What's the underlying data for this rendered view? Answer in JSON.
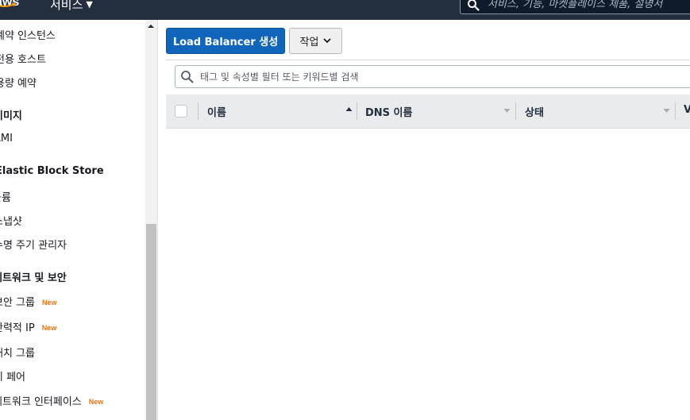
{
  "topbar": {
    "logo_text": "aws",
    "services_label": "서비스",
    "search_placeholder": "서비스, 기능, 마켓플레이스 제품, 설명서"
  },
  "sidebar": {
    "items": [
      {
        "label": "예약 인스턴스",
        "kind": "item"
      },
      {
        "label": "전용 호스트",
        "kind": "item"
      },
      {
        "label": "용량 예약",
        "kind": "item"
      },
      {
        "label": "이미지",
        "kind": "heading"
      },
      {
        "label": "AMI",
        "kind": "item"
      },
      {
        "label": "Elastic Block Store",
        "kind": "heading"
      },
      {
        "label": "볼륨",
        "kind": "item"
      },
      {
        "label": "스냅샷",
        "kind": "item"
      },
      {
        "label": "수명 주기 관리자",
        "kind": "item"
      },
      {
        "label": "네트워크 및 보안",
        "kind": "heading"
      },
      {
        "label": "보안 그룹",
        "kind": "item",
        "badge": "New"
      },
      {
        "label": "탄력적 IP",
        "kind": "item",
        "badge": "New"
      },
      {
        "label": "배치 그룹",
        "kind": "item"
      },
      {
        "label": "키 페어",
        "kind": "item"
      },
      {
        "label": "네트워크 인터페이스",
        "kind": "item",
        "badge": "New"
      }
    ]
  },
  "toolbar": {
    "create_lb_label": "Load Balancer 생성",
    "actions_label": "작업"
  },
  "filter": {
    "placeholder": "태그 및 속성별 필터 또는 키워드별 검색"
  },
  "table": {
    "columns": [
      "이름",
      "DNS 이름",
      "상태",
      "V"
    ],
    "rows": []
  },
  "colors": {
    "nav_bg": "#232f3e",
    "primary_button": "#1166bb",
    "new_badge": "#ec7211"
  }
}
